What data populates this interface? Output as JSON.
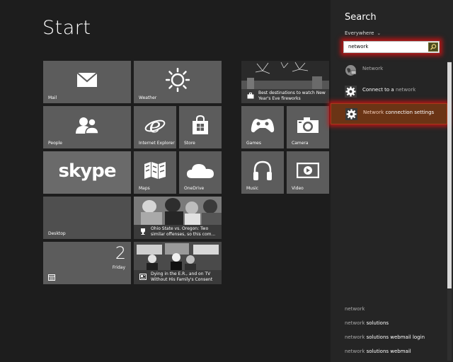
{
  "start": {
    "title": "Start"
  },
  "tiles": {
    "mail": "Mail",
    "weather": "Weather",
    "people": "People",
    "ie": "Internet Explorer",
    "store": "Store",
    "skype": "skype",
    "maps": "Maps",
    "onedrive": "OneDrive",
    "desktop": "Desktop",
    "calendar_day": "2",
    "calendar_weekday": "Friday",
    "games": "Games",
    "camera": "Camera",
    "music": "Music",
    "video": "Video",
    "travel_caption": "Best destinations to watch New Year's Eve fireworks",
    "sports_caption": "Ohio State vs. Oregon: Two similar offenses, so this com...",
    "news_caption": "Dying in the E.R., and on TV Without His Family's Consent"
  },
  "search": {
    "title": "Search",
    "scope": "Everywhere",
    "query": "network",
    "results": [
      {
        "pre": "",
        "match": "Network",
        "post": ""
      },
      {
        "pre": "Connect to a ",
        "match": "network",
        "post": ""
      },
      {
        "pre": "",
        "match": "Network",
        "post": " connection settings"
      }
    ],
    "suggestions": [
      {
        "match": "network",
        "post": ""
      },
      {
        "match": "network",
        "post": " solutions"
      },
      {
        "match": "network",
        "post": " solutions webmail login"
      },
      {
        "match": "network",
        "post": " solutions webmail"
      }
    ]
  },
  "colors": {
    "background": "#1d1d1d",
    "tile": "#5c5c5c",
    "pane": "#252525",
    "selected_result": "#6b3415",
    "highlight_glow": "#c81414"
  }
}
